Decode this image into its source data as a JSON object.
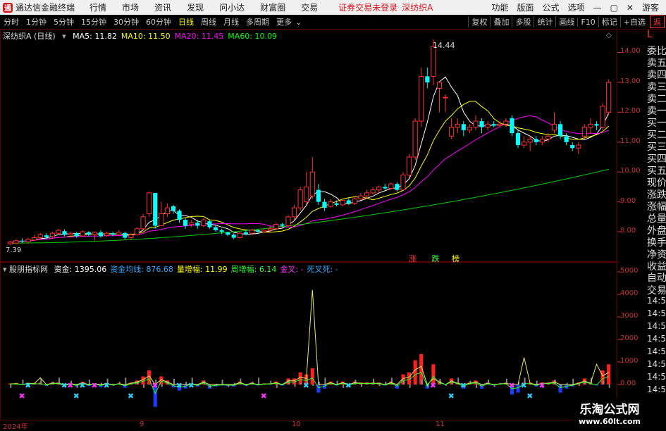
{
  "app": {
    "title": "通达信金融终端",
    "menus": [
      "行情",
      "市场",
      "资讯",
      "发现",
      "问小达",
      "财富圈",
      "交易"
    ],
    "notice": "证券交易未登录",
    "stock_name": "深纺织A",
    "right_menus": [
      "功能",
      "版面",
      "公式",
      "选项"
    ],
    "login": "游客"
  },
  "toolbar": {
    "periods": [
      "分时",
      "1分钟",
      "5分钟",
      "15分钟",
      "30分钟",
      "60分钟",
      "日线",
      "周线",
      "月线",
      "多周期",
      "更多"
    ],
    "active_period": "日线",
    "right_buttons": [
      "复权",
      "叠加",
      "多股",
      "统计",
      "画线",
      "F10",
      "标记",
      "+自选"
    ],
    "back_icon": "返"
  },
  "main_chart": {
    "label": "深纺织A (日线)",
    "ma_legend": [
      {
        "label": "MA5: 11.82",
        "color": "#ffffff"
      },
      {
        "label": "MA10: 11.50",
        "color": "#ffff00"
      },
      {
        "label": "MA20: 11.45",
        "color": "#ff00ff"
      },
      {
        "label": "MA60: 10.09",
        "color": "#00ff00"
      }
    ],
    "y_ticks": [
      "14.00",
      "13.00",
      "12.00",
      "11.00",
      "10.00",
      "9.00",
      "8.00"
    ],
    "high_label": "14.44",
    "low_label": "7.39",
    "markers": [
      {
        "text": "涨",
        "color": "#ff3333"
      },
      {
        "text": "跌",
        "color": "#33ff33"
      },
      {
        "text": "榜",
        "color": "#ffff00"
      }
    ]
  },
  "indicator": {
    "name": "股朋指标网",
    "items": [
      {
        "label": "资金: 1395.06",
        "color": "#ffffff"
      },
      {
        "label": "资金均线: 876.68",
        "color": "#33aaff"
      },
      {
        "label": "量增幅: 11.99",
        "color": "#ffff00"
      },
      {
        "label": "周增幅: 6.14",
        "color": "#33ff33"
      },
      {
        "label": "金叉: -",
        "color": "#ff33ff"
      },
      {
        "label": "死叉死: -",
        "color": "#33aaff"
      }
    ],
    "y_ticks": [
      "5000",
      "4000",
      "3000",
      "2000",
      "1000",
      "0.00"
    ]
  },
  "x_axis": {
    "labels": [
      "2024年",
      "9",
      "10",
      "11"
    ]
  },
  "side_panel": {
    "top": "L",
    "items": [
      "委比",
      "卖五",
      "卖四",
      "卖三",
      "卖二",
      "卖一",
      "买一",
      "买二",
      "买三",
      "买四",
      "买五",
      "现价",
      "涨跌",
      "涨幅",
      "总量",
      "外盘",
      "换手",
      "净资",
      "收益"
    ],
    "bottom_items": [
      "自动",
      "交易",
      "14:56",
      "14:56",
      "14:56",
      "14:56",
      "14:56",
      "14:56",
      "14:56",
      "14:56"
    ]
  },
  "watermark": {
    "title": "乐淘公式网",
    "url": "www.60lt.com"
  },
  "colors": {
    "up": "#ff3232",
    "down": "#00ffff",
    "frame": "#5a0000",
    "ma5": "#ffffff",
    "ma10": "#ffff00",
    "ma20": "#ff00ff",
    "ma60": "#00cc00"
  },
  "chart_data": {
    "type": "candlestick",
    "candles": [
      [
        7.6,
        7.65,
        7.55,
        7.7
      ],
      [
        7.62,
        7.7,
        7.58,
        7.75
      ],
      [
        7.7,
        7.68,
        7.62,
        7.78
      ],
      [
        7.66,
        7.75,
        7.6,
        7.8
      ],
      [
        7.72,
        7.8,
        7.7,
        7.88
      ],
      [
        7.8,
        7.9,
        7.75,
        7.95
      ],
      [
        7.88,
        7.82,
        7.75,
        7.95
      ],
      [
        7.84,
        7.95,
        7.8,
        8.0
      ],
      [
        7.95,
        8.05,
        7.9,
        8.1
      ],
      [
        8.02,
        7.9,
        7.85,
        8.08
      ],
      [
        7.9,
        7.95,
        7.85,
        8.0
      ],
      [
        7.95,
        7.85,
        7.8,
        8.0
      ],
      [
        7.86,
        8.0,
        7.82,
        8.05
      ],
      [
        7.98,
        7.9,
        7.85,
        8.02
      ],
      [
        7.92,
        7.98,
        7.7,
        8.0
      ],
      [
        7.98,
        7.85,
        7.8,
        8.05
      ],
      [
        7.88,
        7.95,
        7.84,
        8.0
      ],
      [
        7.95,
        7.9,
        7.86,
        8.0
      ],
      [
        7.92,
        7.98,
        7.9,
        8.05
      ],
      [
        7.96,
        7.8,
        7.75,
        8.0
      ],
      [
        7.8,
        7.9,
        7.72,
        7.95
      ],
      [
        7.9,
        8.1,
        7.88,
        8.15
      ],
      [
        8.1,
        8.5,
        8.05,
        8.6
      ],
      [
        8.6,
        9.3,
        8.5,
        9.35
      ],
      [
        9.3,
        8.2,
        8.1,
        9.0
      ],
      [
        8.2,
        8.6,
        8.2,
        9.0
      ],
      [
        8.6,
        8.8,
        8.5,
        8.95
      ],
      [
        8.85,
        8.7,
        8.6,
        8.9
      ],
      [
        8.7,
        8.4,
        8.3,
        8.75
      ],
      [
        8.4,
        8.2,
        8.1,
        8.45
      ],
      [
        8.25,
        8.3,
        8.15,
        8.4
      ],
      [
        8.3,
        8.2,
        8.1,
        8.4
      ],
      [
        8.2,
        8.4,
        8.15,
        8.45
      ],
      [
        8.35,
        8.15,
        8.1,
        8.4
      ],
      [
        8.15,
        8.05,
        8.0,
        8.2
      ],
      [
        8.05,
        8.0,
        7.92,
        8.1
      ],
      [
        7.98,
        7.9,
        7.85,
        8.0
      ],
      [
        7.9,
        7.8,
        7.75,
        7.95
      ],
      [
        7.8,
        7.95,
        7.78,
        8.0
      ],
      [
        7.98,
        7.92,
        7.88,
        8.05
      ],
      [
        7.95,
        8.05,
        7.9,
        8.1
      ],
      [
        8.05,
        8.0,
        7.95,
        8.1
      ],
      [
        8.0,
        8.05,
        7.95,
        8.1
      ],
      [
        8.05,
        8.1,
        8.0,
        8.2
      ],
      [
        8.1,
        8.25,
        8.05,
        8.3
      ],
      [
        8.25,
        8.2,
        8.15,
        8.3
      ],
      [
        8.2,
        8.5,
        8.15,
        8.55
      ],
      [
        8.5,
        8.8,
        8.4,
        8.9
      ],
      [
        8.8,
        9.4,
        8.7,
        9.5
      ],
      [
        9.0,
        9.5,
        8.9,
        10.0
      ],
      [
        9.2,
        10.0,
        9.1,
        10.5
      ],
      [
        9.4,
        9.0,
        8.9,
        9.6
      ],
      [
        9.0,
        8.8,
        8.7,
        9.1
      ],
      [
        8.85,
        9.0,
        8.8,
        9.1
      ],
      [
        8.95,
        8.9,
        8.85,
        9.05
      ],
      [
        8.9,
        9.05,
        8.85,
        9.1
      ],
      [
        9.05,
        8.95,
        8.9,
        9.15
      ],
      [
        8.95,
        9.1,
        8.9,
        9.2
      ],
      [
        9.1,
        9.2,
        9.05,
        9.3
      ],
      [
        9.2,
        9.3,
        9.1,
        9.4
      ],
      [
        9.3,
        9.4,
        9.25,
        9.5
      ],
      [
        9.4,
        9.5,
        9.3,
        9.55
      ],
      [
        9.5,
        9.45,
        9.4,
        9.6
      ],
      [
        9.45,
        9.6,
        9.4,
        9.65
      ],
      [
        9.6,
        9.4,
        9.35,
        9.65
      ],
      [
        9.4,
        9.9,
        9.4,
        10.0
      ],
      [
        9.9,
        10.5,
        9.8,
        10.6
      ],
      [
        10.5,
        11.7,
        10.4,
        11.8
      ],
      [
        11.7,
        13.2,
        11.5,
        13.5
      ],
      [
        13.2,
        13.0,
        12.8,
        13.5
      ],
      [
        13.2,
        14.2,
        12.9,
        14.44
      ],
      [
        12.8,
        13.0,
        12.0,
        13.0
      ],
      [
        12.5,
        12.5,
        12.0,
        12.6
      ],
      [
        11.2,
        11.5,
        11.1,
        11.8
      ],
      [
        11.5,
        11.6,
        11.3,
        11.8
      ],
      [
        11.6,
        11.4,
        11.2,
        11.7
      ],
      [
        11.4,
        11.5,
        11.3,
        11.6
      ],
      [
        11.5,
        11.7,
        11.4,
        11.9
      ],
      [
        11.7,
        11.5,
        11.3,
        11.8
      ],
      [
        11.5,
        11.6,
        11.4,
        11.7
      ],
      [
        11.6,
        11.55,
        11.5,
        11.7
      ],
      [
        11.55,
        11.6,
        11.5,
        11.7
      ],
      [
        11.6,
        11.7,
        11.5,
        11.8
      ],
      [
        11.8,
        11.3,
        11.2,
        11.9
      ],
      [
        11.3,
        10.9,
        10.8,
        11.4
      ],
      [
        10.9,
        11.0,
        10.8,
        11.2
      ],
      [
        11.0,
        11.1,
        10.7,
        11.2
      ],
      [
        11.1,
        11.0,
        10.9,
        11.2
      ],
      [
        11.0,
        11.1,
        10.9,
        11.2
      ],
      [
        11.1,
        11.2,
        11.0,
        11.3
      ],
      [
        11.4,
        11.6,
        11.3,
        12.0
      ],
      [
        11.6,
        11.2,
        11.1,
        11.7
      ],
      [
        11.2,
        11.0,
        10.9,
        11.3
      ],
      [
        10.9,
        10.8,
        10.7,
        11.0
      ],
      [
        10.8,
        10.9,
        10.6,
        11.0
      ],
      [
        11.2,
        11.5,
        11.1,
        11.6
      ],
      [
        11.5,
        11.6,
        11.3,
        11.8
      ],
      [
        11.6,
        11.55,
        11.4,
        11.7
      ],
      [
        11.5,
        12.2,
        11.4,
        12.3
      ],
      [
        12.0,
        13.0,
        11.9,
        13.1
      ]
    ]
  }
}
